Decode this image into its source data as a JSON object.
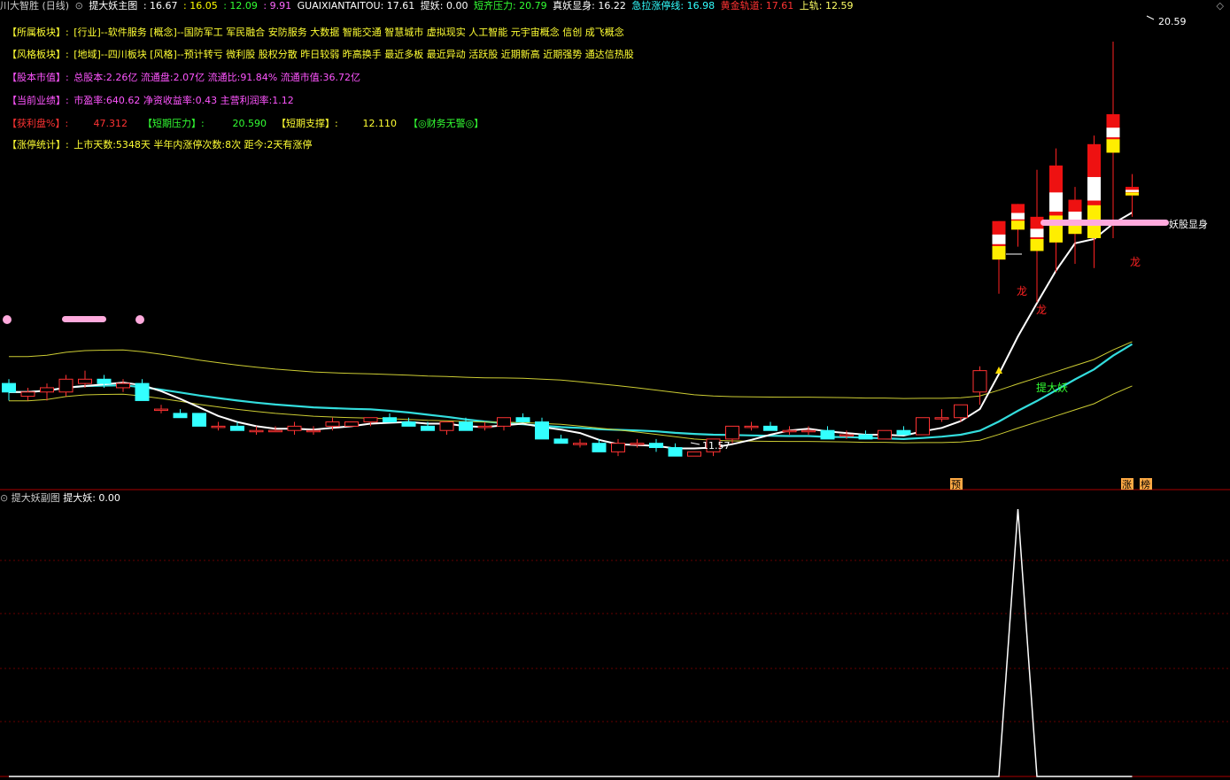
{
  "topbar": {
    "title": "川大智胜 (日线)",
    "indicator_name": "提大妖主图",
    "v1": ": 16.67",
    "v2": ": 16.05",
    "v3": ": 12.09",
    "v4": ": 9.91",
    "guaixian": "GUAIXIANTAITOU: 17.61",
    "tiyao": "提妖: 0.00",
    "duanqi": "短齐压力: 20.79",
    "zhenyao": "真妖显身: 16.22",
    "jila": "急拉涨停线: 16.98",
    "huangjin": "黄金轨道: 17.61",
    "shanggui": "上轨: 12.59",
    "colors": {
      "title": "#cccccc",
      "v1": "#ffffff",
      "v2": "#ffff00",
      "v3": "#33ff33",
      "v4": "#ff66ff",
      "guaixian": "#ffffff",
      "tiyao": "#ffffff",
      "duanqi": "#33ff33",
      "zhenyao": "#ffffff",
      "jila": "#33ffff",
      "huangjin": "#ff3333",
      "shanggui": "#ffff66"
    }
  },
  "info": {
    "sector_label": "【所属板块】:",
    "sector_value": "[行业]--软件服务 [概念]--国防军工 军民融合 安防服务 大数据 智能交通 智慧城市 虚拟现实 人工智能 元宇宙概念 信创 成飞概念",
    "style_label": "【风格板块】:",
    "style_value": "[地域]--四川板块 [风格]--预计转亏 微利股 股权分散 昨日较弱 昨高换手 最近多板 最近异动 活跃股 近期新高 近期强势 通达信热股",
    "market_label": "【股本市值】:",
    "market_value": "总股本:2.26亿 流通盘:2.07亿 流通比:91.84% 流通市值:36.72亿",
    "perf_label": "【当前业绩】:",
    "perf_value": "市盈率:640.62 净资收益率:0.43 主营利润率:1.12",
    "profit_label": "【获利盘%】:",
    "profit_value": "47.312",
    "pressure_label": "【短期压力】:",
    "pressure_value": "20.590",
    "support_label": "【短期支撑】:",
    "support_value": "12.110",
    "finance_label": "【◎财务无警◎】",
    "limit_label": "【涨停统计】:",
    "limit_value": "上市天数:5348天 半年内涨停次数:8次  距今:2天有涨停"
  },
  "annotations": {
    "high_label": "20.59",
    "low_label": "11.57",
    "yao_label": "妖股显身",
    "ti_label": "提大妖",
    "long1": "龙",
    "long2": "龙",
    "long3": "龙",
    "bottom_yu": "预",
    "bottom_zhang": "涨",
    "bottom_bang": "榜"
  },
  "sub": {
    "name": "提大妖副图",
    "value": "提大妖: 0.00",
    "colors": {
      "name": "#cccccc",
      "value": "#ffffff"
    }
  },
  "chart_data": [
    {
      "type": "candlestick",
      "price_range": [
        10.8,
        21.2
      ],
      "series_order": [
        "open",
        "high",
        "low",
        "close"
      ],
      "candles": [
        [
          12.6,
          12.7,
          12.2,
          12.4
        ],
        [
          12.3,
          12.5,
          12.2,
          12.4
        ],
        [
          12.4,
          12.6,
          12.2,
          12.5
        ],
        [
          12.4,
          12.8,
          12.3,
          12.7
        ],
        [
          12.6,
          12.9,
          12.5,
          12.7
        ],
        [
          12.7,
          12.8,
          12.5,
          12.6
        ],
        [
          12.5,
          12.7,
          12.4,
          12.6
        ],
        [
          12.6,
          12.7,
          12.3,
          12.2
        ],
        [
          12.0,
          12.1,
          11.9,
          12.0
        ],
        [
          11.9,
          12.0,
          11.8,
          11.8
        ],
        [
          11.9,
          11.9,
          11.6,
          11.6
        ],
        [
          11.6,
          11.7,
          11.5,
          11.6
        ],
        [
          11.6,
          11.7,
          11.5,
          11.5
        ],
        [
          11.5,
          11.6,
          11.4,
          11.5
        ],
        [
          11.5,
          11.6,
          11.5,
          11.5
        ],
        [
          11.5,
          11.7,
          11.4,
          11.6
        ],
        [
          11.5,
          11.6,
          11.4,
          11.5
        ],
        [
          11.6,
          11.8,
          11.5,
          11.7
        ],
        [
          11.6,
          11.7,
          11.6,
          11.7
        ],
        [
          11.7,
          11.8,
          11.6,
          11.8
        ],
        [
          11.8,
          11.9,
          11.7,
          11.7
        ],
        [
          11.7,
          11.8,
          11.6,
          11.6
        ],
        [
          11.6,
          11.7,
          11.5,
          11.5
        ],
        [
          11.5,
          11.7,
          11.4,
          11.7
        ],
        [
          11.7,
          11.8,
          11.6,
          11.5
        ],
        [
          11.6,
          11.7,
          11.5,
          11.6
        ],
        [
          11.6,
          11.7,
          11.5,
          11.8
        ],
        [
          11.8,
          11.9,
          11.7,
          11.7
        ],
        [
          11.7,
          11.8,
          11.3,
          11.3
        ],
        [
          11.3,
          11.4,
          11.2,
          11.2
        ],
        [
          11.2,
          11.3,
          11.1,
          11.2
        ],
        [
          11.2,
          11.3,
          11.0,
          11.0
        ],
        [
          11.0,
          11.3,
          10.9,
          11.2
        ],
        [
          11.2,
          11.3,
          11.1,
          11.2
        ],
        [
          11.2,
          11.3,
          11.0,
          11.1
        ],
        [
          11.1,
          11.2,
          10.9,
          10.9
        ],
        [
          10.9,
          11.0,
          10.9,
          11.0
        ],
        [
          11.0,
          11.2,
          10.9,
          11.3
        ],
        [
          11.3,
          11.6,
          11.2,
          11.6
        ],
        [
          11.6,
          11.7,
          11.5,
          11.6
        ],
        [
          11.6,
          11.7,
          11.5,
          11.5
        ],
        [
          11.5,
          11.6,
          11.4,
          11.5
        ],
        [
          11.5,
          11.6,
          11.4,
          11.5
        ],
        [
          11.5,
          11.6,
          11.3,
          11.3
        ],
        [
          11.4,
          11.5,
          11.3,
          11.4
        ],
        [
          11.4,
          11.5,
          11.3,
          11.3
        ],
        [
          11.3,
          11.5,
          11.3,
          11.5
        ],
        [
          11.5,
          11.6,
          11.4,
          11.4
        ],
        [
          11.4,
          11.8,
          11.4,
          11.8
        ],
        [
          11.8,
          12.0,
          11.7,
          11.8
        ],
        [
          11.8,
          12.0,
          11.7,
          12.1
        ],
        [
          12.4,
          13.0,
          12.1,
          12.9
        ],
        [
          16.4,
          16.4,
          14.7,
          15.5
        ],
        [
          16.8,
          16.8,
          15.8,
          16.2
        ],
        [
          16.5,
          17.6,
          14.5,
          15.7
        ],
        [
          17.7,
          18.1,
          15.2,
          15.9
        ],
        [
          16.9,
          17.2,
          15.4,
          16.1
        ],
        [
          18.2,
          18.4,
          15.3,
          16.0
        ],
        [
          18.9,
          20.6,
          16.0,
          18.0
        ],
        [
          17.2,
          17.5,
          16.5,
          17.0
        ]
      ]
    },
    {
      "type": "line",
      "title": "提大妖副图",
      "series": [
        {
          "name": "提大妖",
          "values": [
            0,
            0,
            0,
            0,
            0,
            0,
            0,
            0,
            0,
            0,
            0,
            0,
            0,
            0,
            0,
            0,
            0,
            0,
            0,
            0,
            0,
            0,
            0,
            0,
            0,
            0,
            0,
            0,
            0,
            0,
            0,
            0,
            0,
            0,
            0,
            0,
            0,
            0,
            0,
            0,
            0,
            0,
            0,
            0,
            0,
            0,
            0,
            0,
            0,
            0,
            0,
            0,
            0,
            1,
            0,
            0,
            0,
            0,
            0,
            0
          ]
        }
      ]
    }
  ]
}
